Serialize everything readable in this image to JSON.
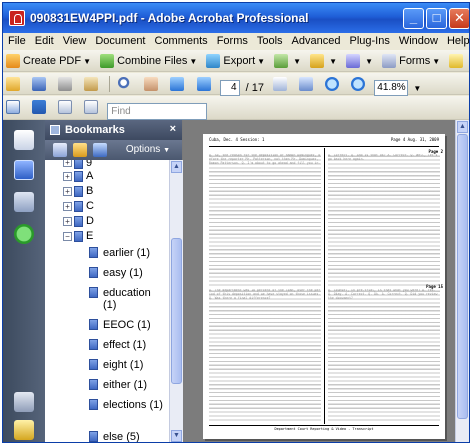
{
  "window": {
    "title": "090831EW4PPI.pdf - Adobe Acrobat Professional",
    "buttons": {
      "minimize": "_",
      "maximize": "□",
      "close": "✕"
    }
  },
  "menu": [
    "File",
    "Edit",
    "View",
    "Document",
    "Comments",
    "Forms",
    "Tools",
    "Advanced",
    "Plug-Ins",
    "Window",
    "Help"
  ],
  "toolbar1": {
    "create_pdf": "Create PDF",
    "combine_files": "Combine Files",
    "export": "Export",
    "forms": "Forms"
  },
  "toolbar2": {
    "current_page": "4",
    "page_total": "/ 17",
    "zoom": "41.8%"
  },
  "toolbar3": {
    "find_placeholder": "Find"
  },
  "bookmarks": {
    "header": "Bookmarks",
    "close": "×",
    "options": "Options",
    "letters": [
      "9",
      "A",
      "B",
      "C",
      "D",
      "E"
    ],
    "items": [
      "earlier (1)",
      "easy (1)",
      "education (1)",
      "EEOC (1)",
      "effect (1)",
      "eight (1)",
      "either (1)",
      "elections (1)",
      "else (5)"
    ]
  },
  "document": {
    "page_header_left": "Cuba, Dec. 4\nSession: 1",
    "page_header_right": "Page 4\nAug. 31, 2009",
    "page_top_label": "Page 2",
    "page_bottom_label": "Page 15",
    "footer": "Department Court Reporting & Video - Transcript",
    "col_tl": "Q. So, the reason for the deposition of Ramon Dominguez, before the reporter Mr. Patterson, not then Mr. Dominguez, Ramon Patterson. Q. I'm about to go ahead and fill you in.",
    "col_tr": "A. Correct. Q. And is that ok? A. Correct. Q. Well, let's go back here again.",
    "col_bl": "A. The department was 18 percent of the loan, over the period of this deposition and we have stayed on those issues. Q. Was there a final difference?",
    "col_br": "Q. Counsel, in pre-trial, is that what you were? A. Yes. Q. Okay. A. Correct. Q. Ok. A. Correct. Q. Did you review the document?"
  },
  "colors": {
    "title_bar": "#1f5fd8",
    "bookmark_header": "#4b586f",
    "nav_strip": "#3c4a5e",
    "doc_background": "#7c7c7c",
    "window_chrome": "#ece9d8"
  }
}
